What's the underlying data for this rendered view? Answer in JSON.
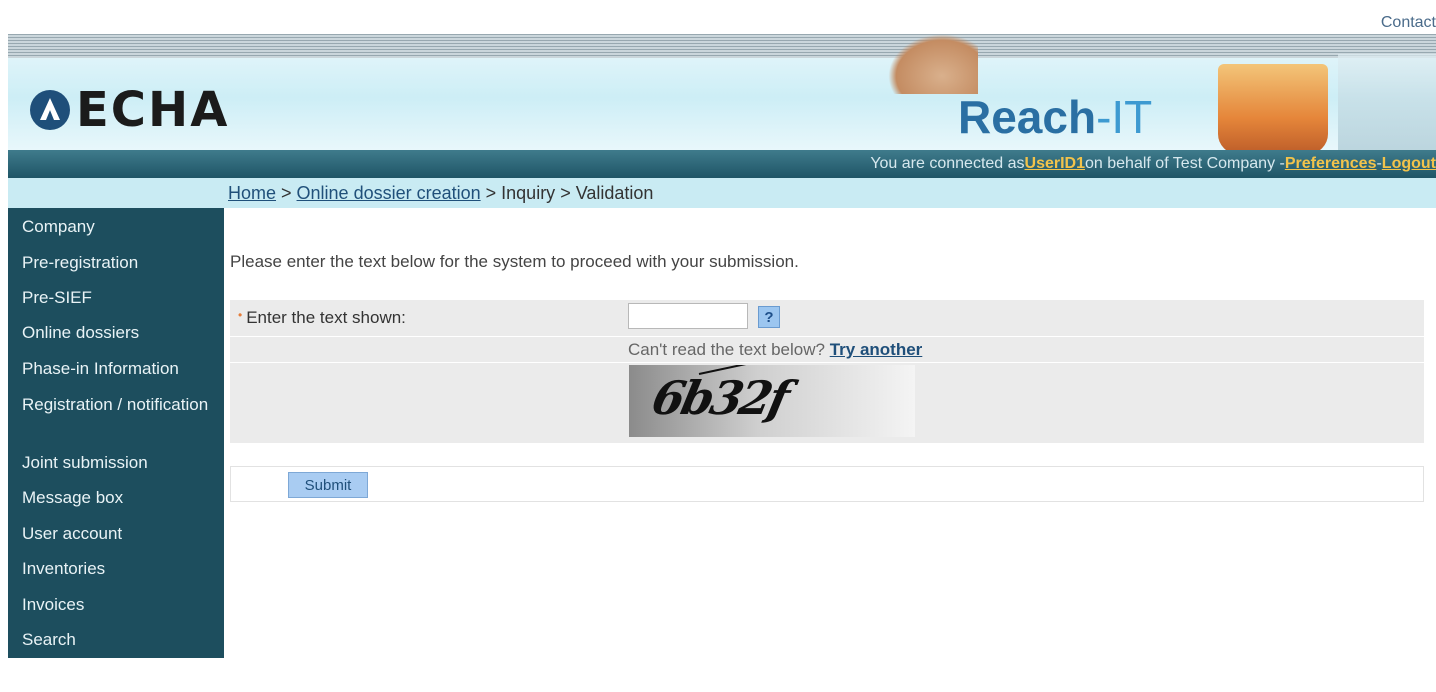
{
  "top": {
    "contact_label": "Contact"
  },
  "header": {
    "logo_text": "ECHA",
    "product_name": "Reach",
    "product_suffix": "-IT"
  },
  "userbar": {
    "prefix": "You are connected as ",
    "user_id": "UserID1",
    "middle": " on behalf of Test Company - ",
    "preferences": "Preferences",
    "separator": " - ",
    "logout": "Logout"
  },
  "breadcrumb": {
    "home": "Home",
    "sep1": " > ",
    "online_dossier": "Online dossier creation",
    "sep2": " > ",
    "inquiry": "Inquiry",
    "sep3": " > ",
    "validation": "Validation"
  },
  "sidebar": {
    "items": [
      {
        "label": "Company"
      },
      {
        "label": "Pre-registration"
      },
      {
        "label": "Pre-SIEF"
      },
      {
        "label": "Online dossiers"
      },
      {
        "label": "Phase-in Information"
      },
      {
        "label": "Registration / notification"
      },
      {
        "label": "Joint submission"
      },
      {
        "label": "Message box"
      },
      {
        "label": "User account"
      },
      {
        "label": "Inventories"
      },
      {
        "label": "Invoices"
      },
      {
        "label": "Search"
      }
    ]
  },
  "main": {
    "intro": "Please enter the text below for the system to proceed with your submission.",
    "captcha_label": "Enter the text shown:",
    "captcha_value": "",
    "help_label": "?",
    "cant_read": "Can't read the text below? ",
    "try_another": "Try another",
    "captcha_text": "6b32f",
    "submit_label": "Submit"
  },
  "colors": {
    "sidebar_bg": "#1d4e5e",
    "userbar_bg": "#1f5566",
    "crumb_bg": "#c9ebf3",
    "link_color": "#20507a",
    "highlight_link": "#f2c34b"
  }
}
